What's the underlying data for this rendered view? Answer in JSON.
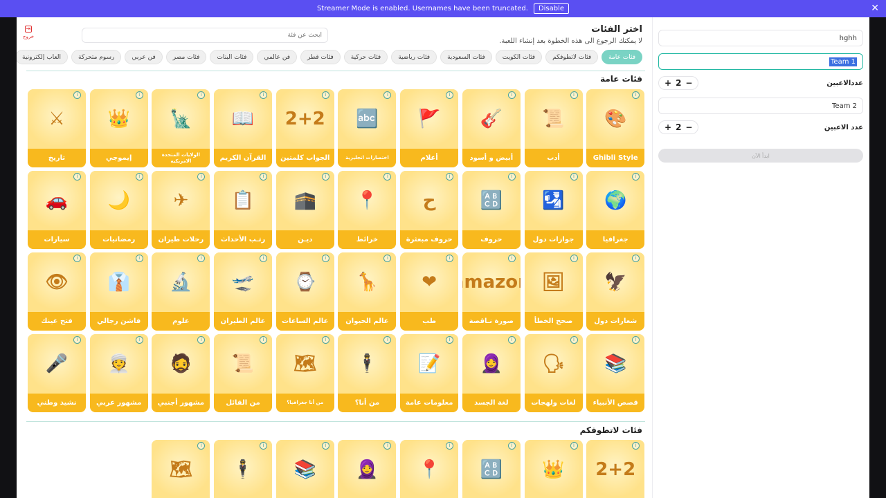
{
  "banner": {
    "message": "Streamer Mode is enabled. Usernames have been truncated.",
    "disable_label": "Disable",
    "close": "✕"
  },
  "header": {
    "title": "اختر الفئات",
    "subtitle": "لا يمكنك الرجوع الى هذه الخطوة بعد إنشاء اللعبة.",
    "search_placeholder": "ابحث عن فئة",
    "logout_label": "خروج",
    "logout_icon": "logout-icon"
  },
  "pills": [
    "فئات عامة",
    "فئات لاتطوفكم",
    "فئات الكويت",
    "فئات السعودية",
    "فئات رياضية",
    "فئات حركية",
    "فئات قطر",
    "فن عالمي",
    "فئات البنات",
    "فئات مصر",
    "فن عربي",
    "رسوم متحركة",
    "العاب إلكترونية"
  ],
  "sections": [
    {
      "title": "فئات عامة",
      "cards": [
        {
          "label": "Ghibli Style",
          "glyph": "🎨"
        },
        {
          "label": "أدب",
          "glyph": "📜"
        },
        {
          "label": "أبيض و أسود",
          "glyph": "🎸"
        },
        {
          "label": "أعلام",
          "glyph": "🚩"
        },
        {
          "label": "اختصارات انجليزية",
          "glyph": "🔤",
          "small": true
        },
        {
          "label": "الجواب كلمتين",
          "glyph": "2+2"
        },
        {
          "label": "القرآن الكريم",
          "glyph": "📖"
        },
        {
          "label": "الولايات المتحدة الامريكية",
          "glyph": "🗽",
          "small": true
        },
        {
          "label": "إيموجي",
          "glyph": "👑"
        },
        {
          "label": "تاريخ",
          "glyph": "⚔"
        },
        {
          "label": "جغرافيا",
          "glyph": "🌍"
        },
        {
          "label": "جوازات دول",
          "glyph": "🛂"
        },
        {
          "label": "حروف",
          "glyph": "🔠"
        },
        {
          "label": "حروف مبعثرة",
          "glyph": "ح"
        },
        {
          "label": "خرائط",
          "glyph": "📍"
        },
        {
          "label": "ديـن",
          "glyph": "🕋"
        },
        {
          "label": "رتـب الأحداث",
          "glyph": "📋"
        },
        {
          "label": "رحلات طيران",
          "glyph": "✈"
        },
        {
          "label": "رمضانيات",
          "glyph": "🌙"
        },
        {
          "label": "سيارات",
          "glyph": "🚗"
        },
        {
          "label": "شعارات دول",
          "glyph": "🦅"
        },
        {
          "label": "صحح الخطأ",
          "glyph": "🖼"
        },
        {
          "label": "صورة نـاقصة",
          "glyph": "amazon"
        },
        {
          "label": "طب",
          "glyph": "❤"
        },
        {
          "label": "عالم الحيوان",
          "glyph": "🦒"
        },
        {
          "label": "عالم الساعات",
          "glyph": "⌚"
        },
        {
          "label": "عالم الطيران",
          "glyph": "🛫"
        },
        {
          "label": "علوم",
          "glyph": "🔬"
        },
        {
          "label": "فاشن رجالي",
          "glyph": "👔"
        },
        {
          "label": "فتح عينك",
          "glyph": "👁"
        },
        {
          "label": "قصص الأنبياء",
          "glyph": "📚"
        },
        {
          "label": "لغات ولهجات",
          "glyph": "🗣"
        },
        {
          "label": "لغة الجسد",
          "glyph": "🧕"
        },
        {
          "label": "معلومات عامة",
          "glyph": "📝"
        },
        {
          "label": "من أنا؟",
          "glyph": "🕴"
        },
        {
          "label": "من أنا جغرافيا؟",
          "glyph": "🗺",
          "small": true
        },
        {
          "label": "من القائل",
          "glyph": "📜"
        },
        {
          "label": "مشهور أجنبي",
          "glyph": "🧔"
        },
        {
          "label": "مشهور عربي",
          "glyph": "👳"
        },
        {
          "label": "نشيد وطني",
          "glyph": "🎤"
        }
      ]
    },
    {
      "title": "فئات لاتطوفكم",
      "cards": [
        {
          "label": "",
          "glyph": "2+2"
        },
        {
          "label": "",
          "glyph": "👑"
        },
        {
          "label": "",
          "glyph": "🔠"
        },
        {
          "label": "",
          "glyph": "📍"
        },
        {
          "label": "",
          "glyph": "🧕"
        },
        {
          "label": "",
          "glyph": "📚"
        },
        {
          "label": "",
          "glyph": "🕴"
        },
        {
          "label": "",
          "glyph": "🗺"
        }
      ]
    }
  ],
  "sidebar": {
    "username": "hghh",
    "team1": {
      "name_prefix": "",
      "name_selected": "Team 1",
      "players_label": "عددالاعبين",
      "count": "2"
    },
    "team2": {
      "name": "Team 2",
      "players_label": "عدد الاعبين",
      "count": "2"
    },
    "start_label": "ابدأ الآن",
    "plus": "+",
    "minus": "−"
  }
}
